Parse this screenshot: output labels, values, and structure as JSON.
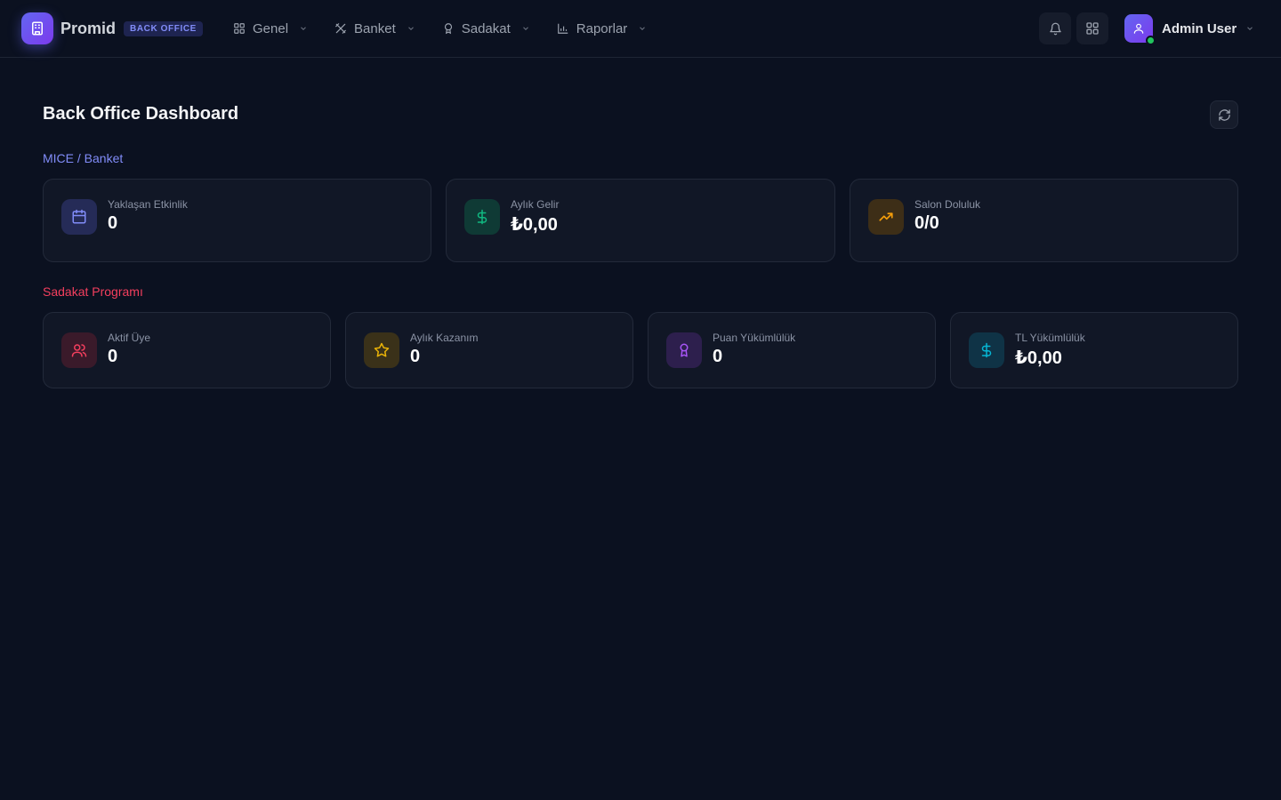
{
  "brand": {
    "name": "Promid",
    "badge": "BACK OFFICE"
  },
  "nav": [
    {
      "label": "Genel",
      "icon": "grid-icon"
    },
    {
      "label": "Banket",
      "icon": "utensils-icon"
    },
    {
      "label": "Sadakat",
      "icon": "award-icon"
    },
    {
      "label": "Raporlar",
      "icon": "bar-chart-icon"
    }
  ],
  "topbar": {
    "notifications_icon": "bell-icon",
    "apps_icon": "apps-grid-icon"
  },
  "user": {
    "name": "Admin User",
    "status": "online"
  },
  "page": {
    "title": "Back Office Dashboard",
    "refresh_icon": "refresh-icon"
  },
  "sections": {
    "mice": {
      "title": "MICE / Banket",
      "color": "#818cf8",
      "cards": [
        {
          "label": "Yaklaşan Etkinlik",
          "value": "0",
          "icon": "calendar-icon",
          "color": "#818cf8",
          "bg": "#252b57"
        },
        {
          "label": "Aylık Gelir",
          "value": "₺0,00",
          "icon": "dollar-icon",
          "color": "#10b981",
          "bg": "#0f3a35"
        },
        {
          "label": "Salon Doluluk",
          "value": "0/0",
          "icon": "trending-up-icon",
          "color": "#f59e0b",
          "bg": "#3d2e17"
        }
      ]
    },
    "loyalty": {
      "title": "Sadakat Programı",
      "color": "#f43f5e",
      "cards": [
        {
          "label": "Aktif Üye",
          "value": "0",
          "icon": "users-icon",
          "color": "#f43f5e",
          "bg": "#3a1a2a"
        },
        {
          "label": "Aylık Kazanım",
          "value": "0",
          "icon": "star-icon",
          "color": "#eab308",
          "bg": "#3a3119"
        },
        {
          "label": "Puan Yükümlülük",
          "value": "0",
          "icon": "award-icon",
          "color": "#a855f7",
          "bg": "#2d1f4d"
        },
        {
          "label": "TL Yükümlülük",
          "value": "₺0,00",
          "icon": "dollar-icon",
          "color": "#06b6d4",
          "bg": "#0f3346"
        }
      ]
    }
  }
}
